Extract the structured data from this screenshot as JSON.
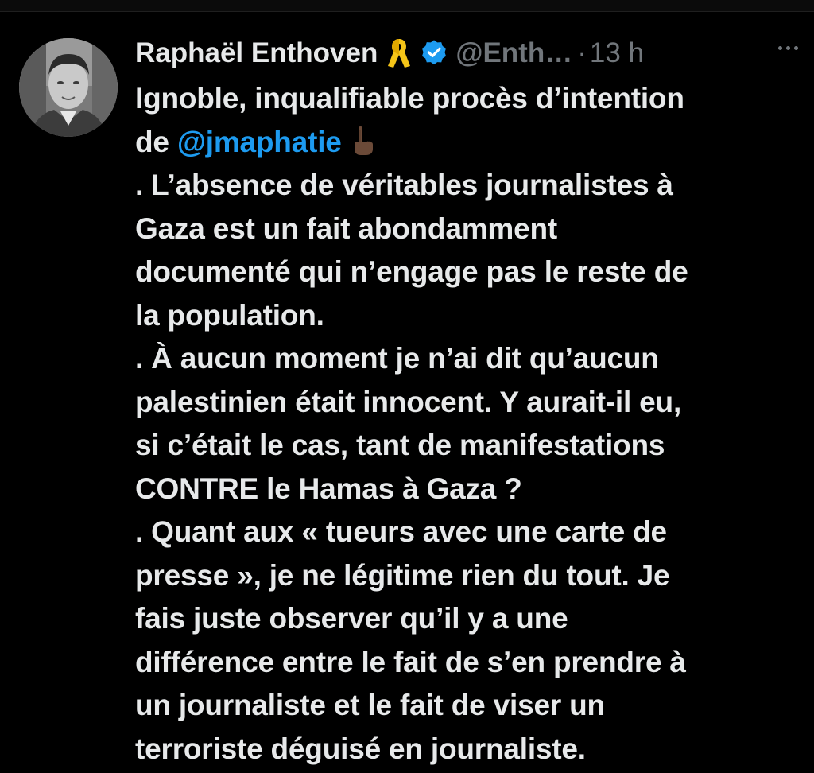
{
  "tweet": {
    "author": {
      "display_name": "Raphaël Enthoven",
      "handle": "@Enth…",
      "badge_icons": [
        "yellow-ribbon-icon",
        "verified-badge-icon"
      ]
    },
    "separator": "·",
    "time": "13 h",
    "more_icon": "more-options-icon",
    "line1": "Ignoble, inqualifiable procès d’intention",
    "line2_prefix": "de ",
    "mention": "@jmaphatie",
    "line3": ". L’absence de véritables journalistes à",
    "line4": "Gaza est un fait abondamment",
    "line5": "documenté  qui n’engage pas le reste de",
    "line6": "la population.",
    "line7": ". À aucun moment je n’ai dit qu’aucun",
    "line8": "palestinien était innocent. Y aurait-il eu,",
    "line9": "si c’était le cas, tant de manifestations",
    "line10": "CONTRE le Hamas à Gaza ?",
    "line11": ". Quant aux « tueurs avec une carte de",
    "line12": "presse », je ne légitime rien du tout. Je",
    "line13": "fais juste observer qu’il y a une",
    "line14": "différence entre le fait de s’en prendre à",
    "line15": "un journaliste et le fait de viser un",
    "line16": "terroriste déguisé en journaliste."
  },
  "colors": {
    "background": "#000000",
    "text": "#e7e9ea",
    "secondary": "#71767b",
    "link": "#1d9bf0",
    "verified": "#1d9bf0",
    "ribbon": "#f5c518"
  }
}
